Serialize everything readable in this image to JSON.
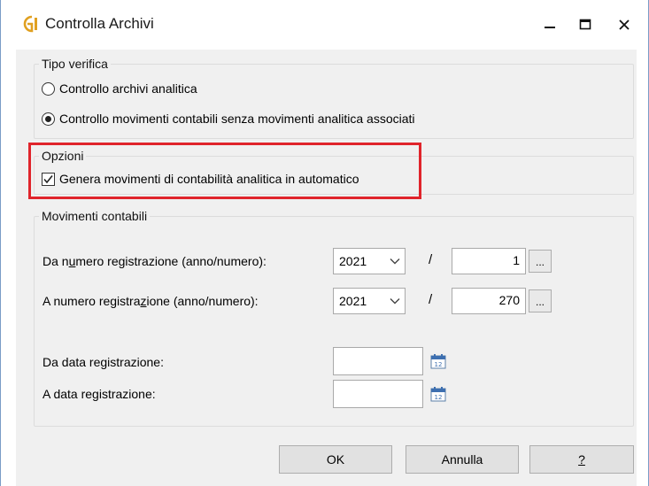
{
  "window": {
    "title": "Controlla Archivi",
    "accent_color": "#e0a020"
  },
  "tipo_verifica": {
    "legend": "Tipo verifica",
    "options": [
      {
        "label": "Controllo archivi analitica",
        "checked": false
      },
      {
        "label": "Controllo movimenti contabili senza movimenti analitica associati",
        "checked": true
      }
    ]
  },
  "opzioni": {
    "legend": "Opzioni",
    "genera_label": "Genera movimenti di contabilità analitica in automatico",
    "genera_checked": true,
    "highlight_color": "#e0242b"
  },
  "movimenti": {
    "legend": "Movimenti contabili",
    "da_numero": {
      "label_pre": "Da n",
      "label_underlined": "u",
      "label_post": "mero registrazione (anno/numero):",
      "year": "2021",
      "number": "1"
    },
    "a_numero": {
      "label_pre": "A numero registra",
      "label_underlined": "z",
      "label_post": "ione (anno/numero):",
      "year": "2021",
      "number": "270"
    },
    "slash": "/",
    "ellipsis": "...",
    "da_data_label": "Da data registrazione:",
    "da_data_value": "",
    "a_data_label": "A data registrazione:",
    "a_data_value": "",
    "calendar_icon_text": "12"
  },
  "buttons": {
    "ok": "OK",
    "annulla": "Annulla",
    "help": "?"
  }
}
